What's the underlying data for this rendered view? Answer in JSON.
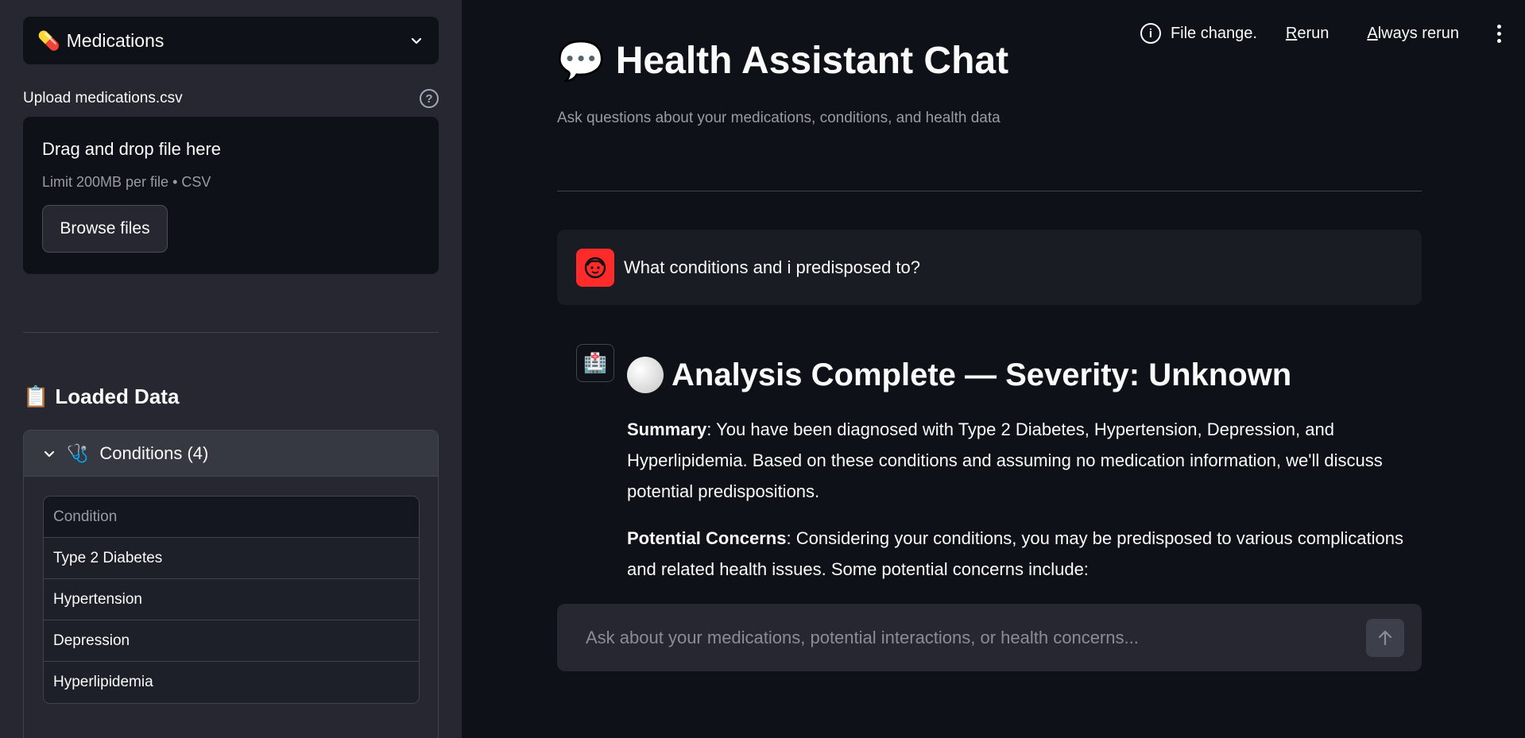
{
  "sidebar": {
    "medications_select": {
      "icon": "💊",
      "label": "Medications"
    },
    "upload": {
      "label": "Upload medications.csv",
      "help": "?",
      "dropzone_title": "Drag and drop file here",
      "dropzone_limit": "Limit 200MB per file • CSV",
      "browse_label": "Browse files"
    },
    "loaded_data": {
      "icon": "📋",
      "title": "Loaded Data"
    },
    "conditions_expander": {
      "icon": "🩺",
      "label": "Conditions (4)",
      "table": {
        "header": "Condition",
        "rows": [
          "Type 2 Diabetes",
          "Hypertension",
          "Depression",
          "Hyperlipidemia"
        ]
      }
    }
  },
  "toolbar": {
    "status": "File change.",
    "rerun_first": "R",
    "rerun_rest": "erun",
    "always_first": "A",
    "always_rest": "lways rerun"
  },
  "main": {
    "title_icon": "💬",
    "title": "Health Assistant Chat",
    "subtitle": "Ask questions about your medications, conditions, and health data",
    "user_message": "What conditions and i predisposed to?",
    "assistant": {
      "avatar": "🏥",
      "heading": "Analysis Complete — Severity: Unknown",
      "summary_label": "Summary",
      "summary_text": ": You have been diagnosed with Type 2 Diabetes, Hypertension, Depression, and Hyperlipidemia. Based on these conditions and assuming no medication information, we'll discuss potential predispositions.",
      "concerns_label": "Potential Concerns",
      "concerns_text": ": Considering your conditions, you may be predisposed to various complications and related health issues. Some potential concerns include:"
    },
    "chat_input": {
      "placeholder": "Ask about your medications, potential interactions, or health concerns..."
    }
  },
  "colors": {
    "sidebar_bg": "#262730",
    "main_bg": "#0e1117",
    "user_avatar": "#ff2b2b"
  }
}
